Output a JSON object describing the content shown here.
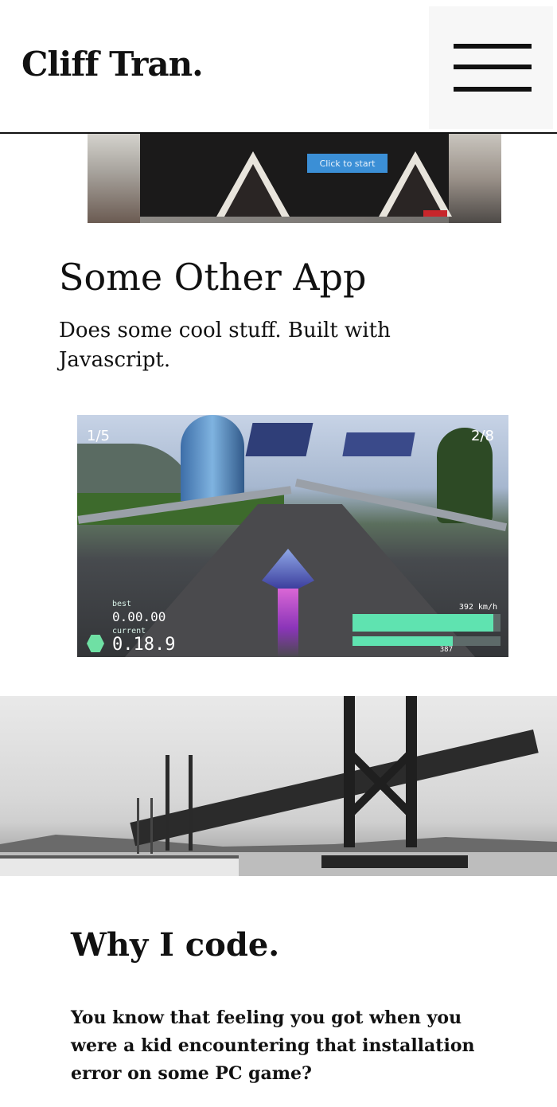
{
  "header": {
    "brand": "Cliff Tran.",
    "menu_icon": "hamburger-icon"
  },
  "project_one": {
    "start_button": "Click to start"
  },
  "project_two": {
    "title": "Some Other App",
    "description": "Does some cool stuff. Built with Javascript.",
    "game_hud": {
      "lap": "1/5",
      "position": "2/8",
      "best_label": "best",
      "best_time": "0.00.00",
      "current_label": "current",
      "current_time": "0.18.9",
      "speed": "392 km/h",
      "thrust_fraction": 0.95,
      "shield_fraction": 0.68,
      "sub_value": "387"
    }
  },
  "why_section": {
    "title": "Why I code.",
    "text": "You know that feeling you got when you were a kid encountering that installation error on some PC game?"
  }
}
